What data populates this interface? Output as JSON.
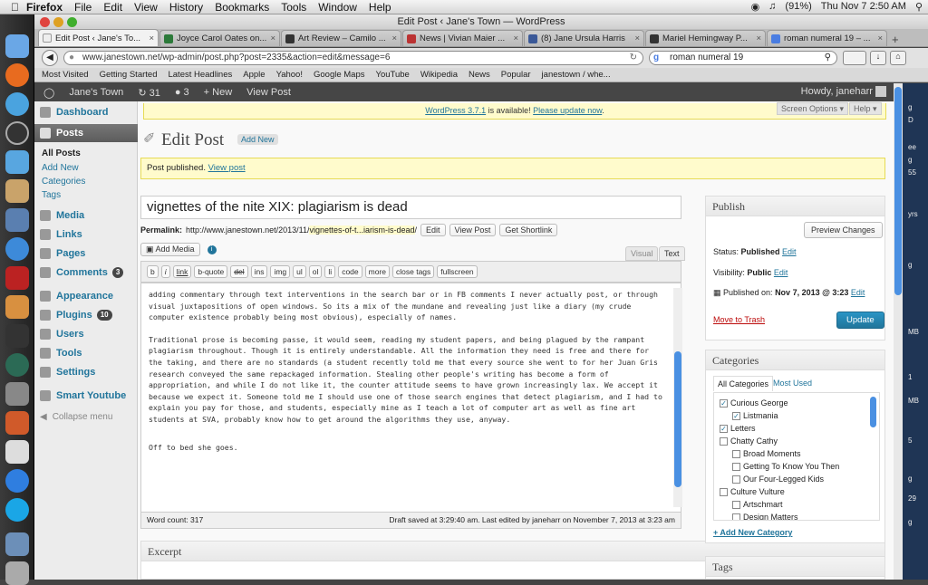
{
  "menubar": {
    "app": "Firefox",
    "items": [
      "File",
      "Edit",
      "View",
      "History",
      "Bookmarks",
      "Tools",
      "Window",
      "Help"
    ],
    "battery": "(91%)",
    "clock": "Thu Nov 7  2:50 AM"
  },
  "window": {
    "title": "Edit Post ‹ Jane's Town — WordPress"
  },
  "tabs": [
    "Edit Post ‹ Jane's To...",
    "Joyce Carol Oates on...",
    "Art Review – Camilo ...",
    "News | Vivian Maier ...",
    "(8) Jane Ursula Harris",
    "Mariel Hemingway P...",
    "roman numeral 19 – ..."
  ],
  "nav": {
    "url": "www.janestown.net/wp-admin/post.php?post=2335&action=edit&message=6",
    "search": "roman numeral 19"
  },
  "bookmarks": [
    "Most Visited",
    "Getting Started",
    "Latest Headlines",
    "Apple",
    "Yahoo!",
    "Google Maps",
    "YouTube",
    "Wikipedia",
    "News",
    "Popular",
    "janestown / whe..."
  ],
  "adminbar": {
    "site": "Jane's Town",
    "updates": "31",
    "comments": "3",
    "new": "+ New",
    "view": "View Post",
    "howdy": "Howdy, janeharr"
  },
  "sidebar": {
    "dashboard": "Dashboard",
    "posts": "Posts",
    "sub": [
      "All Posts",
      "Add New",
      "Categories",
      "Tags"
    ],
    "media": "Media",
    "links": "Links",
    "pages": "Pages",
    "comments": "Comments",
    "comments_count": "3",
    "appearance": "Appearance",
    "plugins": "Plugins",
    "plugins_count": "10",
    "users": "Users",
    "tools": "Tools",
    "settings": "Settings",
    "smart": "Smart Youtube",
    "collapse": "Collapse menu"
  },
  "notice": {
    "pre": "WordPress 3.7.1",
    "mid": " is available! ",
    "link": "Please update now",
    "end": "."
  },
  "screen_options": "Screen Options ▾",
  "help": "Help ▾",
  "heading": "Edit Post",
  "add_new": "Add New",
  "published": {
    "text": "Post published. ",
    "link": "View post"
  },
  "post_title": "vignettes of the nite XIX: plagiarism is dead",
  "permalink": {
    "label": "Permalink:",
    "base": "http://www.janestown.net/2013/11/",
    "slug": "vignettes-of-t...iarism-is-dead",
    "tail": "/",
    "edit": "Edit",
    "view": "View Post",
    "short": "Get Shortlink"
  },
  "add_media": "Add Media",
  "editor_tabs": {
    "visual": "Visual",
    "text": "Text"
  },
  "quicktags": [
    "b",
    "i",
    "link",
    "b-quote",
    "del",
    "ins",
    "img",
    "ul",
    "ol",
    "li",
    "code",
    "more",
    "close tags",
    "fullscreen"
  ],
  "content": [
    "adding commentary through text interventions in the search bar or in FB comments I never actually post, or through visual juxtapositions of open windows. So its a mix of the mundane and revealing just like a diary (my crude computer existence probably being most obvious), especially of names.",
    "Traditional prose is becoming passe, it would seem, reading my student papers, and being plagued by the rampant plagiarism throughout.  Though it is entirely understandable. All the information they need is free and there for the taking, and there are no standards (a student recently told me that every source she went to for her Juan Gris research conveyed the same repackaged information. Stealing other people's writing has become a form of appropriation, and while I do not like it, the counter attitude seems to have grown increasingly lax. We accept it because we expect it. Someone told me I should use one of those search engines that detect plagiarism, and I had to explain you pay for those, and students, especially mine as I teach a lot of computer art as well as fine art students at SVA, probably know how to get around the algorithms they use, anyway.",
    "Off to bed she goes."
  ],
  "footer": {
    "word_count": "Word count: 317",
    "draft": "Draft saved at 3:29:40 am. Last edited by janeharr on November 7, 2013 at 3:23 am"
  },
  "excerpt": "Excerpt",
  "publish": {
    "title": "Publish",
    "preview": "Preview Changes",
    "status_label": "Status: ",
    "status": "Published",
    "visibility_label": "Visibility: ",
    "visibility": "Public",
    "published_label": "Published on: ",
    "published_on": "Nov 7, 2013 @ 3:23",
    "edit": "Edit",
    "trash": "Move to Trash",
    "update": "Update"
  },
  "categories": {
    "title": "Categories",
    "tab_all": "All Categories",
    "tab_used": "Most Used",
    "items": [
      {
        "label": "Curious George",
        "checked": true
      },
      {
        "label": "Listmania",
        "checked": true
      },
      {
        "label": "Letters",
        "checked": true
      },
      {
        "label": "Chatty Cathy",
        "checked": false
      },
      {
        "label": "Broad Moments",
        "checked": false
      },
      {
        "label": "Getting To Know You Then",
        "checked": false
      },
      {
        "label": "Our Four-Legged Kids",
        "checked": false
      },
      {
        "label": "Culture Vulture",
        "checked": false
      },
      {
        "label": "Artschmart",
        "checked": false
      },
      {
        "label": "Design Matters",
        "checked": false
      }
    ],
    "add": "+ Add New Category"
  },
  "tags": {
    "title": "Tags"
  },
  "right_strip": [
    "g",
    "D",
    "ee",
    "g",
    "55",
    "yrs",
    "g",
    "MB",
    "1",
    "MB",
    "5",
    "g",
    "29",
    "g"
  ]
}
